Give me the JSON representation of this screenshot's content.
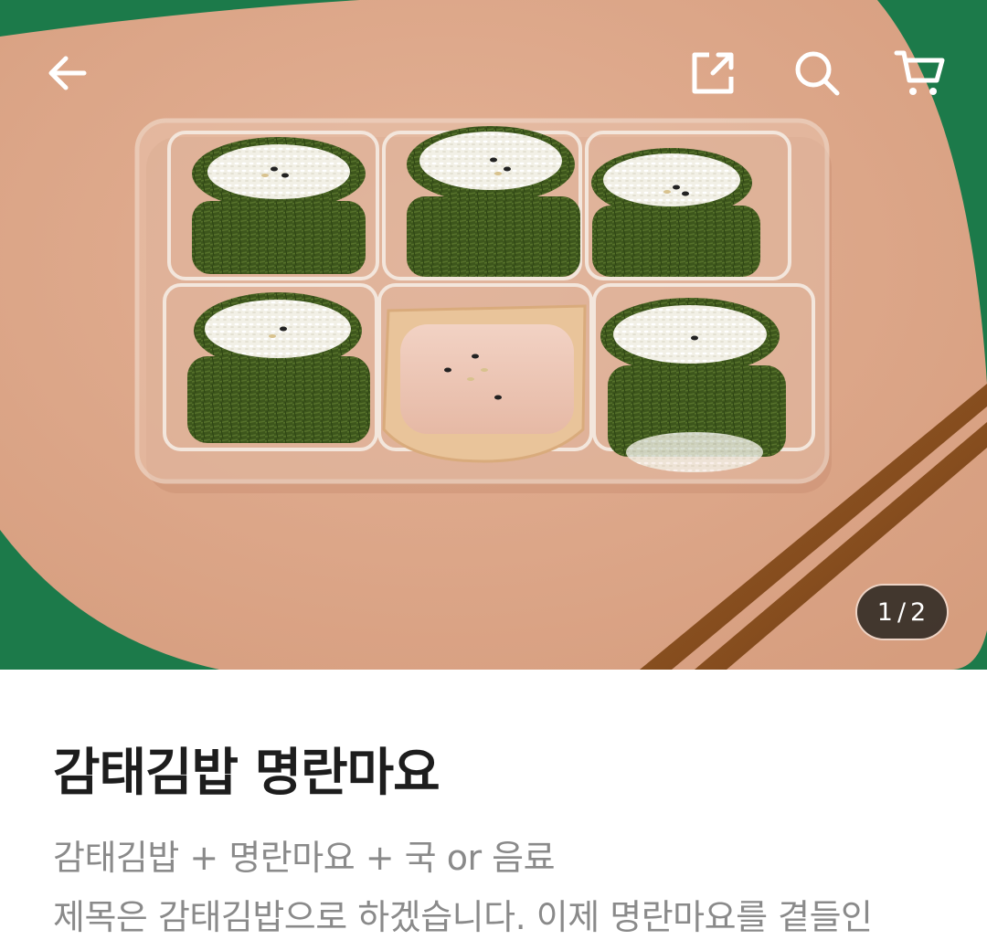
{
  "image_counter": {
    "current": "1",
    "separator": "/",
    "total": "2"
  },
  "product": {
    "title": "감태김밥 명란마요",
    "description_line1": "감태김밥 + 명란마요 + 국 or 음료",
    "description_line2": "제목은 감태김밥으로 하겠습니다. 이제 명란마요를 곁들인"
  },
  "icons": {
    "back": "arrow-left-icon",
    "share": "share-icon",
    "search": "search-icon",
    "cart": "cart-icon"
  },
  "colors": {
    "background_green": "#1c7a4a",
    "board": "#dfa98a",
    "seaweed": "#3f5a1e",
    "title": "#1d1d1d",
    "description": "#8a8a8a"
  }
}
